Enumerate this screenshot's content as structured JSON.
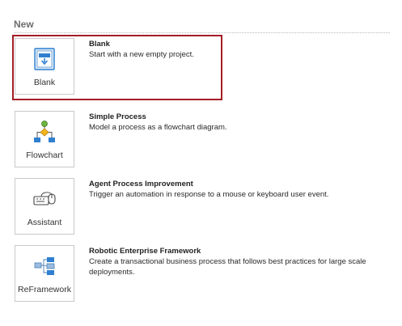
{
  "section": {
    "title": "New"
  },
  "templates": [
    {
      "tile_label": "Blank",
      "name": "Blank",
      "description": "Start with a new empty project.",
      "icon": "blank-project-icon",
      "selected": true
    },
    {
      "tile_label": "Flowchart",
      "name": "Simple Process",
      "description": "Model a process as a flowchart diagram.",
      "icon": "flowchart-icon",
      "selected": false
    },
    {
      "tile_label": "Assistant",
      "name": "Agent Process Improvement",
      "description": "Trigger an automation in response to a mouse or keyboard user event.",
      "icon": "keyboard-mouse-icon",
      "selected": false
    },
    {
      "tile_label": "ReFramework",
      "name": "Robotic Enterprise Framework",
      "description": "Create a transactional business process that follows best practices for large scale deployments.",
      "icon": "reframework-icon",
      "selected": false
    }
  ],
  "colors": {
    "selection_border": "#a51d26",
    "accent_blue": "#2f7fd0",
    "accent_green": "#6db33f",
    "accent_yellow": "#f2b51d"
  }
}
